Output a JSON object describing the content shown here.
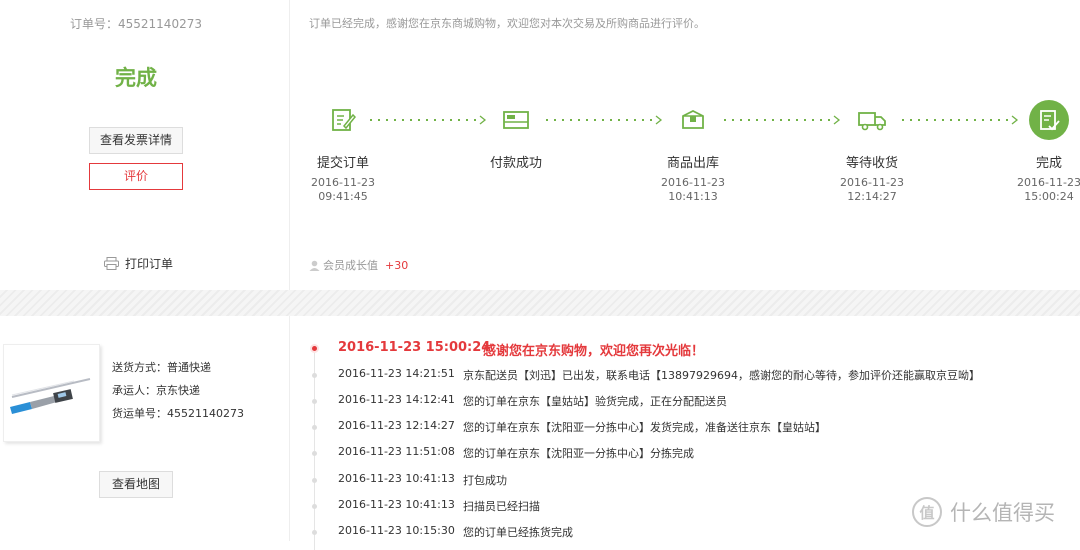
{
  "order": {
    "number_label": "订单号：45521140273",
    "status": "完成",
    "invoice_button": "查看发票详情",
    "review_button": "评价",
    "print_label": "打印订单"
  },
  "complete_message": "订单已经完成，感谢您在京东商城购物，欢迎您对本次交易及所购商品进行评价。",
  "steps": [
    {
      "name": "提交订单",
      "date": "2016-11-23",
      "time": "09:41:45",
      "icon": "edit-document-icon"
    },
    {
      "name": "付款成功",
      "date": "",
      "time": "",
      "icon": "payment-card-icon"
    },
    {
      "name": "商品出库",
      "date": "2016-11-23",
      "time": "10:41:13",
      "icon": "package-box-icon"
    },
    {
      "name": "等待收货",
      "date": "2016-11-23",
      "time": "12:14:27",
      "icon": "delivery-truck-icon"
    },
    {
      "name": "完成",
      "date": "2016-11-23",
      "time": "15:00:24",
      "icon": "complete-check-icon"
    }
  ],
  "growth": {
    "label": "会员成长值",
    "value": "+30"
  },
  "shipping": {
    "method": "送货方式：普通快递",
    "carrier": "承运人：京东快递",
    "tracking": "货运单号：45521140273",
    "map_button": "查看地图"
  },
  "timeline": [
    {
      "time": "2016-11-23 15:00:24",
      "msg": "感谢您在京东购物，欢迎您再次光临！"
    },
    {
      "time": "2016-11-23 14:21:51",
      "msg": "京东配送员【刘迅】已出发，联系电话【13897929694，感谢您的耐心等待，参加评价还能赢取京豆呦】"
    },
    {
      "time": "2016-11-23 14:12:41",
      "msg": "您的订单在京东【皇姑站】验货完成，正在分配配送员"
    },
    {
      "time": "2016-11-23 12:14:27",
      "msg": "您的订单在京东【沈阳亚一分拣中心】发货完成，准备送往京东【皇姑站】"
    },
    {
      "time": "2016-11-23 11:51:08",
      "msg": "您的订单在京东【沈阳亚一分拣中心】分拣完成"
    },
    {
      "time": "2016-11-23 10:41:13",
      "msg": "打包成功"
    },
    {
      "time": "2016-11-23 10:41:13",
      "msg": "扫描员已经扫描"
    },
    {
      "time": "2016-11-23 10:15:30",
      "msg": "您的订单已经拣货完成"
    }
  ],
  "watermark": {
    "icon": "值",
    "text": "什么值得买"
  },
  "colors": {
    "green": "#71b247",
    "red": "#e4393c"
  }
}
